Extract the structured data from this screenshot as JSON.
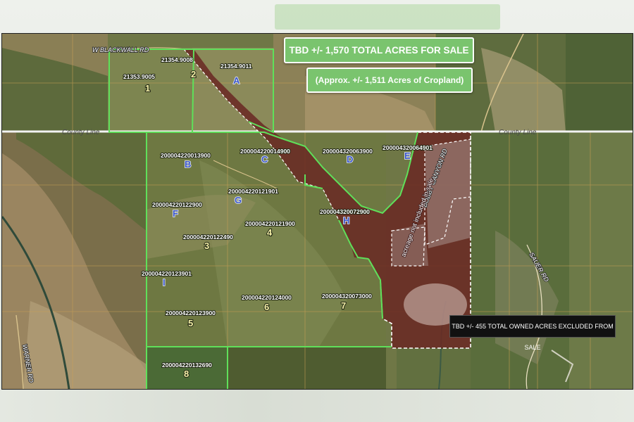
{
  "banners": {
    "total_acres": "TBD +/- 1,570 TOTAL ACRES FOR SALE",
    "cropland": "(Approx. +/- 1,511 Acres of Cropland)",
    "excluded": "TBD +/- 455 TOTAL OWNED ACRES EXCLUDED FROM SALE"
  },
  "roads": {
    "county_line_left": "County Line",
    "county_line_right": "County Line",
    "blackwall": "W BLACKWALL RD",
    "bobby_canyon": "BOBBY CANYON RD",
    "sauer": "SAUER RD",
    "warner": "WARNER RD"
  },
  "excluded_note": "acreage not included in sale",
  "parcels": [
    {
      "id": "21353.9005",
      "label": "1"
    },
    {
      "id": "21354.9008",
      "label": "2"
    },
    {
      "id": "21354.9011",
      "label": "A"
    },
    {
      "id": "200004220013900",
      "label": "B"
    },
    {
      "id": "200004220014900",
      "label": "C"
    },
    {
      "id": "200004320063900",
      "label": "D"
    },
    {
      "id": "200004320064901",
      "label": "E"
    },
    {
      "id": "200004220122900",
      "label": "F"
    },
    {
      "id": "200004220121901",
      "label": "G"
    },
    {
      "id": "200004320072900",
      "label": "H"
    },
    {
      "id": "200004220122490",
      "label": "3"
    },
    {
      "id": "200004220121900",
      "label": "4"
    },
    {
      "id": "200004220123901",
      "label": "I"
    },
    {
      "id": "200004220123900",
      "label": "5"
    },
    {
      "id": "200004220124000",
      "label": "6"
    },
    {
      "id": "200004320073000",
      "label": "7"
    },
    {
      "id": "200004220132690",
      "label": "8"
    }
  ],
  "colors": {
    "sale_boundary": "#5fe05a",
    "excluded_fill": "#6a2a24",
    "banner_green": "#7ac46e",
    "parcel_grid": "#c9a055"
  }
}
